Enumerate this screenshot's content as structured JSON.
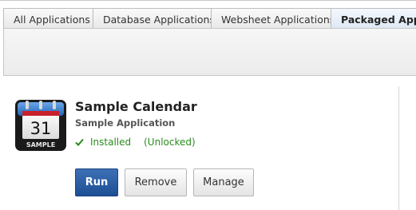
{
  "tabs": [
    {
      "label": "All Applications"
    },
    {
      "label": "Database Applications"
    },
    {
      "label": "Websheet Applications"
    },
    {
      "label": "Packaged Applic"
    }
  ],
  "app": {
    "icon_month": "",
    "icon_day": "31",
    "icon_badge": "SAMPLE",
    "title": "Sample Calendar",
    "subtitle": "Sample Application",
    "status": "Installed",
    "lock_state": "(Unlocked)"
  },
  "buttons": {
    "run": "Run",
    "remove": "Remove",
    "manage": "Manage"
  },
  "colors": {
    "status_green": "#2a8a1e",
    "primary_button": "#2a5ea6",
    "active_tab": "#dce7f3"
  },
  "icons": {
    "app": "calendar-icon",
    "status": "checkmark-icon"
  }
}
